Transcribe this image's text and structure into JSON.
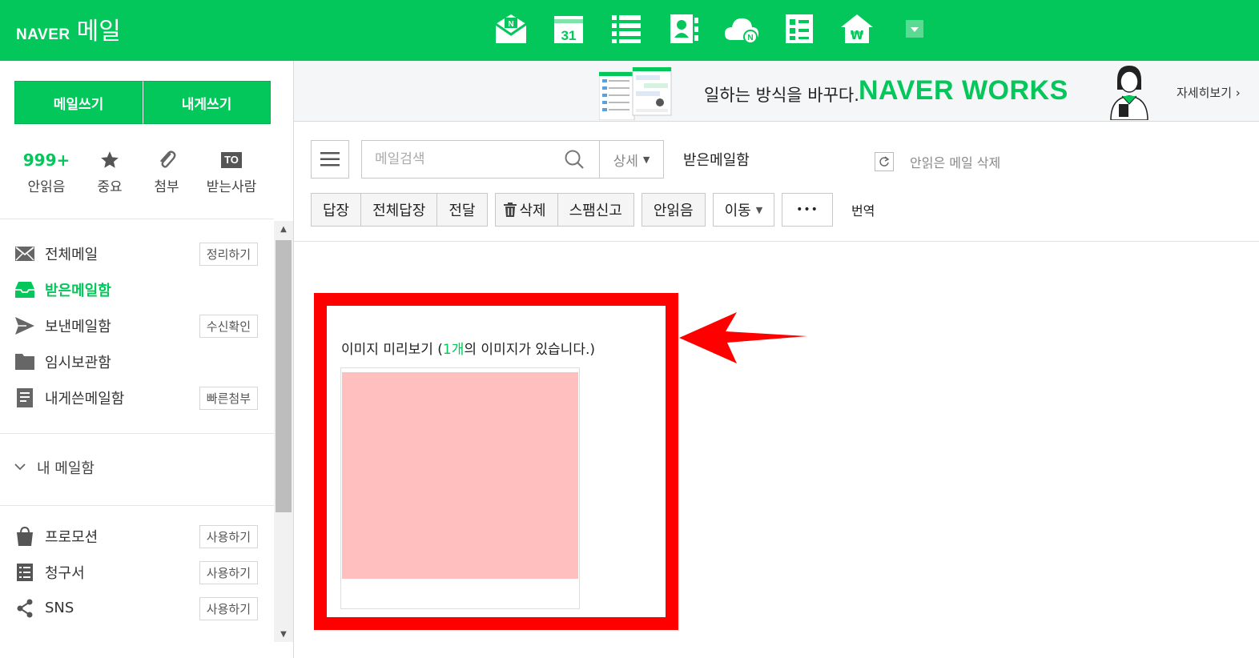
{
  "header": {
    "brand_naver": "NAVER",
    "brand_mail": "메일",
    "apps": [
      "mail-icon",
      "calendar-icon",
      "list-icon",
      "contacts-icon",
      "cloud-icon",
      "memo-icon",
      "pay-icon",
      "more-dropdown-icon"
    ],
    "calendar_day": "31",
    "color": "#03c75a"
  },
  "sidebar": {
    "compose_label": "메일쓰기",
    "self_compose_label": "내게쓰기",
    "quick": [
      {
        "top": "999+",
        "label": "안읽음"
      },
      {
        "top": "star-icon",
        "label": "중요"
      },
      {
        "top": "clip-icon",
        "label": "첨부"
      },
      {
        "top": "TO",
        "label": "받는사람"
      }
    ],
    "folders": [
      {
        "name": "전체메일",
        "button": "정리하기",
        "icon": "envelope-icon"
      },
      {
        "name": "받은메일함",
        "button": "",
        "icon": "inbox-icon",
        "active": true
      },
      {
        "name": "보낸메일함",
        "button": "수신확인",
        "icon": "send-icon"
      },
      {
        "name": "임시보관함",
        "button": "",
        "icon": "folder-icon"
      },
      {
        "name": "내게쓴메일함",
        "button": "빠른첨부",
        "icon": "note-icon"
      }
    ],
    "my_mailbox": "내 메일함",
    "extras": [
      {
        "name": "프로모션",
        "button": "사용하기",
        "icon": "bag-icon"
      },
      {
        "name": "청구서",
        "button": "사용하기",
        "icon": "bill-icon"
      },
      {
        "name": "SNS",
        "button": "사용하기",
        "icon": "share-icon"
      }
    ]
  },
  "banner": {
    "slogan": "일하는 방식을 바꾸다.",
    "product": "NAVER WORKS",
    "more": "자세히보기 ›"
  },
  "toolbar": {
    "search_placeholder": "메일검색",
    "detail": "상세",
    "current_folder": "받은메일함",
    "delete_unread": "안읽은 메일 삭제",
    "actions1": [
      "답장",
      "전체답장",
      "전달"
    ],
    "actions2": [
      "삭제",
      "스팸신고"
    ],
    "unread": "안읽음",
    "move": "이동",
    "more": "•••",
    "translate": "번역"
  },
  "preview": {
    "title_prefix": "이미지 미리보기 (",
    "count": "1개",
    "title_suffix": "의 이미지가 있습니다.)",
    "image_color": "#ffbfbf",
    "highlight_color": "#ff0000"
  }
}
